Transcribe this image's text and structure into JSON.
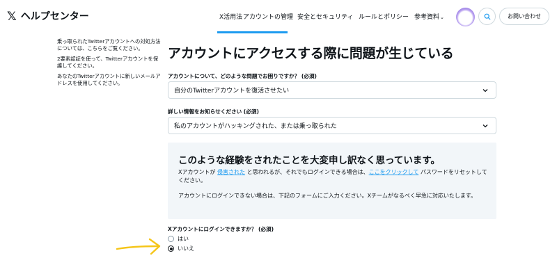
{
  "header": {
    "logo_glyph": "𝕏",
    "site_name": "ヘルプセンター",
    "nav": [
      {
        "label": "X活用法",
        "active": true
      },
      {
        "label": "アカウントの管理",
        "active": false
      },
      {
        "label": "安全とセキュリティ",
        "active": false
      },
      {
        "label": "ルールとポリシー",
        "active": false
      },
      {
        "label": "参考資料",
        "active": false
      }
    ],
    "nav_dropdown_glyph": "⌄",
    "contact_label": "お問い合わせ",
    "accent_color": "#1d9bf0"
  },
  "sidebar": {
    "paragraphs": [
      "乗っ取られたTwitterアカウントへの対処方法については、こちらをご覧ください。",
      "2要素認証を使って、Twitterアカウントを保護してください。",
      "あなたのTwitterアカウントに新しいメールアドレスを使用してください。"
    ]
  },
  "main": {
    "title": "アカウントにアクセスする際に問題が生じている",
    "field1": {
      "label": "アカウントについて、どのような問題でお困りですか？ (必須)",
      "value": "自分のTwitterアカウントを復活させたい"
    },
    "field2": {
      "label": "詳しい情報をお知らせください (必須)",
      "value": "私のアカウントがハッキングされた、または乗っ取られた"
    },
    "apology": {
      "title": "このような経験をされたことを大変申し訳なく思っています。",
      "p1_a": "Xアカウントが ",
      "p1_link1": "侵害された",
      "p1_b": " と思われるが、それでもログインできる場合は、",
      "p1_link2": "ここをクリックして",
      "p1_c": " パスワードをリセットしてください。",
      "p2": "アカウントにログインできない場合は、下記のフォームにご入力ください。Xチームがなるべく早急に対応いたします。"
    },
    "question": {
      "label": "Xアカウントにログインできますか？ (必須)",
      "options": [
        {
          "label": "はい",
          "selected": false
        },
        {
          "label": "いいえ",
          "selected": true
        }
      ]
    }
  },
  "annotation": {
    "arrow_color": "#f5c518"
  }
}
